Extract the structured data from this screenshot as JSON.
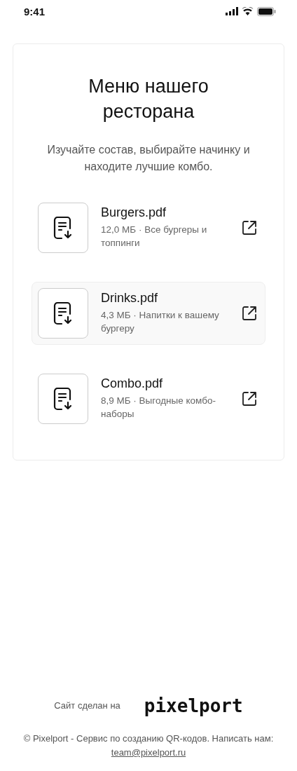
{
  "status_bar": {
    "time": "9:41"
  },
  "card": {
    "title": "Меню нашего ресторана",
    "subtitle": "Изучайте состав, выбирайте начинку и находите лучшие комбо.",
    "files": [
      {
        "name": "Burgers.pdf",
        "description": "12,0 МБ · Все бургеры и топпинги",
        "selected": false
      },
      {
        "name": "Drinks.pdf",
        "description": "4,3 МБ · Напитки к вашему бургеру",
        "selected": true
      },
      {
        "name": "Combo.pdf",
        "description": "8,9 МБ · Выгодные комбо-наборы",
        "selected": false
      }
    ]
  },
  "footer": {
    "made_by": "Сайт сделан на",
    "logo": "pixelport",
    "copyright": "© Pixelport - Сервис по созданию QR-кодов. Написать нам:",
    "email": "team@pixelport.ru"
  }
}
